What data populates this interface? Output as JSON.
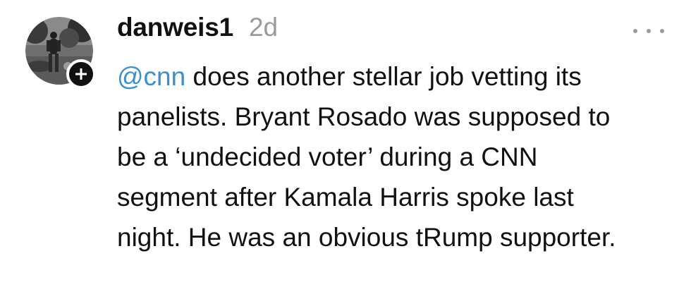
{
  "post": {
    "username": "danweis1",
    "timestamp": "2d",
    "mention": "@cnn",
    "lines": [
      " does another stellar job vetting its",
      "panelists. Bryant Rosado was supposed to",
      "be a ‘undecided voter’ during a CNN",
      "segment after Kamala Harris spoke last",
      "night. He was an obvious tRump supporter."
    ]
  },
  "icons": {
    "follow": "plus-icon",
    "more": "more-horizontal-icon"
  },
  "colors": {
    "mention": "#3a8fd0",
    "timestamp": "#9a9a9a",
    "text": "#111111",
    "badge": "#111111"
  }
}
